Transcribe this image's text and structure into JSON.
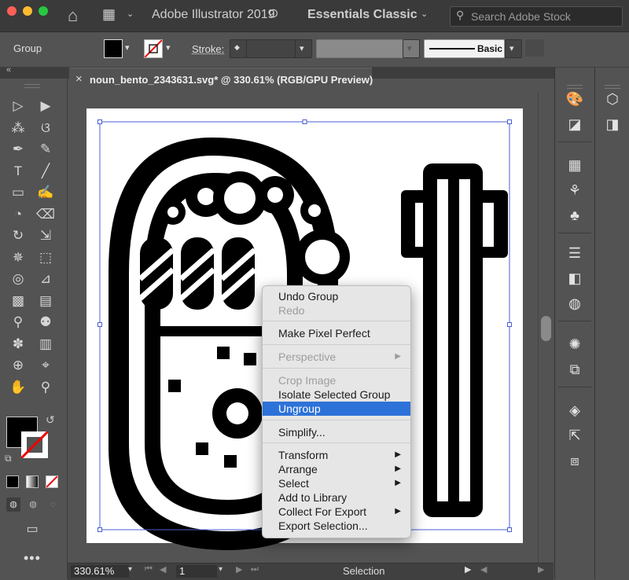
{
  "app_title": "Adobe Illustrator 2019",
  "workspace": "Essentials Classic",
  "stock_search": {
    "placeholder": "Search Adobe Stock"
  },
  "control_bar": {
    "selection_type": "Group",
    "stroke_label": "Stroke:",
    "brush_label": "Basic"
  },
  "document_tab": {
    "close": "×",
    "title": "noun_bento_2343631.svg* @ 330.61% (RGB/GPU Preview)"
  },
  "status_bar": {
    "zoom": "330.61%",
    "artboard_number": "1",
    "tool_name": "Selection"
  },
  "context_menu": {
    "items": [
      {
        "label": "Undo Group",
        "enabled": true
      },
      {
        "label": "Redo",
        "enabled": false
      },
      {
        "label": "Make Pixel Perfect",
        "enabled": true
      },
      {
        "label": "Perspective",
        "enabled": false,
        "submenu": true
      },
      {
        "label": "Crop Image",
        "enabled": false
      },
      {
        "label": "Isolate Selected Group",
        "enabled": true
      },
      {
        "label": "Ungroup",
        "enabled": true,
        "highlighted": true
      },
      {
        "label": "Simplify...",
        "enabled": true
      },
      {
        "label": "Transform",
        "enabled": true,
        "submenu": true
      },
      {
        "label": "Arrange",
        "enabled": true,
        "submenu": true
      },
      {
        "label": "Select",
        "enabled": true,
        "submenu": true
      },
      {
        "label": "Add to Library",
        "enabled": true
      },
      {
        "label": "Collect For Export",
        "enabled": true,
        "submenu": true
      },
      {
        "label": "Export Selection...",
        "enabled": true
      }
    ]
  },
  "colors": {
    "highlight": "#2d72d9",
    "ui_dark": "#535353",
    "artwork": "#000000"
  },
  "toolbar_icons": [
    "selection-tool-icon",
    "direct-selection-tool-icon",
    "magic-wand-tool-icon",
    "lasso-tool-icon",
    "pen-tool-icon",
    "curvature-tool-icon",
    "type-tool-icon",
    "line-tool-icon",
    "rectangle-tool-icon",
    "paintbrush-tool-icon",
    "shaper-tool-icon",
    "eraser-tool-icon",
    "rotate-tool-icon",
    "scale-tool-icon",
    "puppet-warp-tool-icon",
    "free-transform-tool-icon",
    "shape-builder-tool-icon",
    "perspective-grid-tool-icon",
    "mesh-tool-icon",
    "gradient-tool-icon",
    "eyedropper-tool-icon",
    "blend-tool-icon",
    "symbol-sprayer-tool-icon",
    "column-graph-tool-icon",
    "artboard-tool-icon",
    "slice-tool-icon",
    "hand-tool-icon",
    "zoom-tool-icon"
  ]
}
